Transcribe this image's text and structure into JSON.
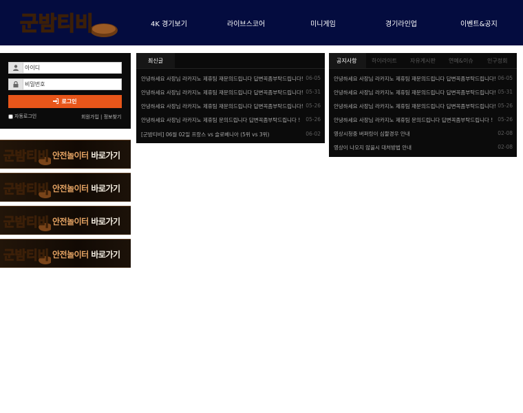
{
  "site": {
    "logo_text": "군밤티비"
  },
  "nav": [
    {
      "label": "4K 경기보기"
    },
    {
      "label": "라이브스코어"
    },
    {
      "label": "미니게임"
    },
    {
      "label": "경기라인업"
    },
    {
      "label": "이벤트&공지"
    }
  ],
  "login": {
    "id_placeholder": "아이디",
    "pw_placeholder": "비밀번호",
    "button_label": "로그인",
    "auto_login_label": "자동로그인",
    "signup_label": "회원가입",
    "separator": "|",
    "find_label": "정보찾기"
  },
  "banners": [
    {
      "logo_text": "군밤티비",
      "text_highlight": "안전놀이터",
      "text_rest": " 바로가기"
    },
    {
      "logo_text": "군밤티비",
      "text_highlight": "안전놀이터",
      "text_rest": " 바로가기"
    },
    {
      "logo_text": "군밤티비",
      "text_highlight": "안전놀이터",
      "text_rest": " 바로가기"
    },
    {
      "logo_text": "군밤티비",
      "text_highlight": "안전놀이터",
      "text_rest": " 바로가기"
    }
  ],
  "recent": {
    "tab_label": "최신글",
    "rows": [
      {
        "title": "안녕하세요 사장님 라카지노 제휴팀 재문의드립니다 답변꼭좀부탁드립니다!",
        "date": "06-05"
      },
      {
        "title": "안녕하세요 사장님 라카지노 제휴팀 재문의드립니다 답변꼭좀부탁드립니다!",
        "date": "05-31"
      },
      {
        "title": "안녕하세요 사장님 라카지노 제휴팀 재문의드립니다 답변꼭좀부탁드립니다!",
        "date": "05-26"
      },
      {
        "title": "안녕하세요 사장님 라카지노 제휴팀 문의드립니다 답변꼭좀부탁드립니다 !",
        "date": "05-26"
      },
      {
        "title": "[군밤티비] 06월 02일 프랑스 vs 슬로베니아 (5위 vs 3위)",
        "date": "06-02"
      }
    ]
  },
  "notice": {
    "tabs": [
      {
        "label": "공지사항",
        "active": true
      },
      {
        "label": "하이라이트",
        "active": false
      },
      {
        "label": "자유게시판",
        "active": false
      },
      {
        "label": "연예&이슈",
        "active": false
      },
      {
        "label": "인구정회",
        "active": false
      }
    ],
    "rows": [
      {
        "title": "안녕하세요 사장님 라카지노 제휴팀 재문의드립니다 답변꼭좀부탁드립니다!",
        "date": "06-05"
      },
      {
        "title": "안녕하세요 사장님 라카지노 제휴팀 재문의드립니다 답변꼭좀부탁드립니다!",
        "date": "05-31"
      },
      {
        "title": "안녕하세요 사장님 라카지노 제휴팀 재문의드립니다 답변꼭좀부탁드립니다!",
        "date": "05-26"
      },
      {
        "title": "안녕하세요 사장님 라카지노 제휴팀 문의드립니다 답변꼭좀부탁드립니다 !",
        "date": "05-26"
      },
      {
        "title": "영상시청중 버퍼링이 심할경우 안내",
        "date": "02-08"
      },
      {
        "title": "영상이 나오지 않을시 대처방법 안내",
        "date": "02-08"
      }
    ]
  },
  "colors": {
    "header": "#040c3f",
    "login_button": "#e8561a",
    "panel": "#0b0b0b",
    "logo_gold": "#c98a44"
  }
}
